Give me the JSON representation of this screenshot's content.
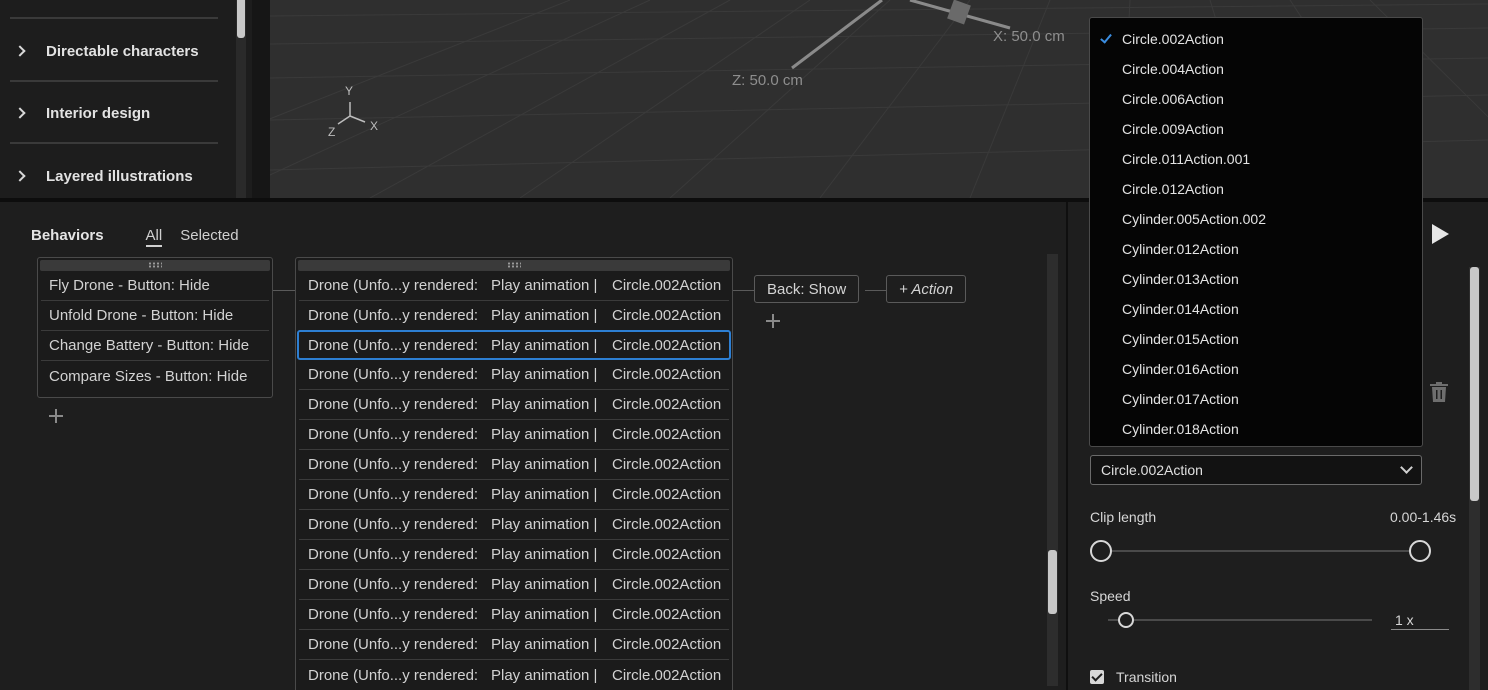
{
  "library": {
    "items": [
      {
        "label": "Directable characters"
      },
      {
        "label": "Interior design"
      },
      {
        "label": "Layered illustrations"
      }
    ]
  },
  "viewport": {
    "x_readout": "X:  50.0 cm",
    "z_readout": "Z:  50.0 cm",
    "axis_y": "Y",
    "axis_z": "Z",
    "axis_x": "X"
  },
  "behaviors": {
    "title": "Behaviors",
    "tabs": [
      {
        "label": "All"
      },
      {
        "label": "Selected"
      }
    ],
    "triggers": [
      {
        "label": "Fly Drone - Button:  Hide"
      },
      {
        "label": "Unfold Drone - Button:  Hide"
      },
      {
        "label": "Change Battery - Button:   Hide"
      },
      {
        "label": "Compare Sizes - Button:  Hide"
      }
    ],
    "actions": [
      {
        "target": "Drone (Unfo...y rendered:",
        "verb": "Play animation |",
        "clip": "Circle.002Action"
      },
      {
        "target": "Drone (Unfo...y rendered:",
        "verb": "Play animation |",
        "clip": "Circle.002Action"
      },
      {
        "target": "Drone (Unfo...y rendered:",
        "verb": "Play animation |",
        "clip": "Circle.002Action"
      },
      {
        "target": "Drone (Unfo...y rendered:",
        "verb": "Play animation |",
        "clip": "Circle.002Action"
      },
      {
        "target": "Drone (Unfo...y rendered:",
        "verb": "Play animation |",
        "clip": "Circle.002Action"
      },
      {
        "target": "Drone (Unfo...y rendered:",
        "verb": "Play animation |",
        "clip": "Circle.002Action"
      },
      {
        "target": "Drone (Unfo...y rendered:",
        "verb": "Play animation |",
        "clip": "Circle.002Action"
      },
      {
        "target": "Drone (Unfo...y rendered:",
        "verb": "Play animation |",
        "clip": "Circle.002Action"
      },
      {
        "target": "Drone (Unfo...y rendered:",
        "verb": "Play animation |",
        "clip": "Circle.002Action"
      },
      {
        "target": "Drone (Unfo...y rendered:",
        "verb": "Play animation |",
        "clip": "Circle.002Action"
      },
      {
        "target": "Drone (Unfo...y rendered:",
        "verb": "Play animation |",
        "clip": "Circle.002Action"
      },
      {
        "target": "Drone (Unfo...y rendered:",
        "verb": "Play animation |",
        "clip": "Circle.002Action"
      },
      {
        "target": "Drone (Unfo...y rendered:",
        "verb": "Play animation |",
        "clip": "Circle.002Action"
      },
      {
        "target": "Drone (Unfo...y rendered:",
        "verb": "Play animation |",
        "clip": "Circle.002Action"
      }
    ],
    "selected_action_index": 2,
    "back_chip": "Back:  Show",
    "add_action_chip": "+ Action"
  },
  "properties": {
    "clip_selected": "Circle.002Action",
    "clip_options": [
      "Circle.002Action",
      "Circle.004Action",
      "Circle.006Action",
      "Circle.009Action",
      "Circle.011Action.001",
      "Circle.012Action",
      "Cylinder.005Action.002",
      "Cylinder.012Action",
      "Cylinder.013Action",
      "Cylinder.014Action",
      "Cylinder.015Action",
      "Cylinder.016Action",
      "Cylinder.017Action",
      "Cylinder.018Action"
    ],
    "clip_length_label": "Clip length",
    "clip_length_value": "0.00-1.46s",
    "speed_label": "Speed",
    "speed_value": "1 x",
    "transition_label": "Transition",
    "transition_checked": true
  },
  "colors": {
    "accent": "#2d7fd3",
    "background": "#1e1e1e"
  }
}
